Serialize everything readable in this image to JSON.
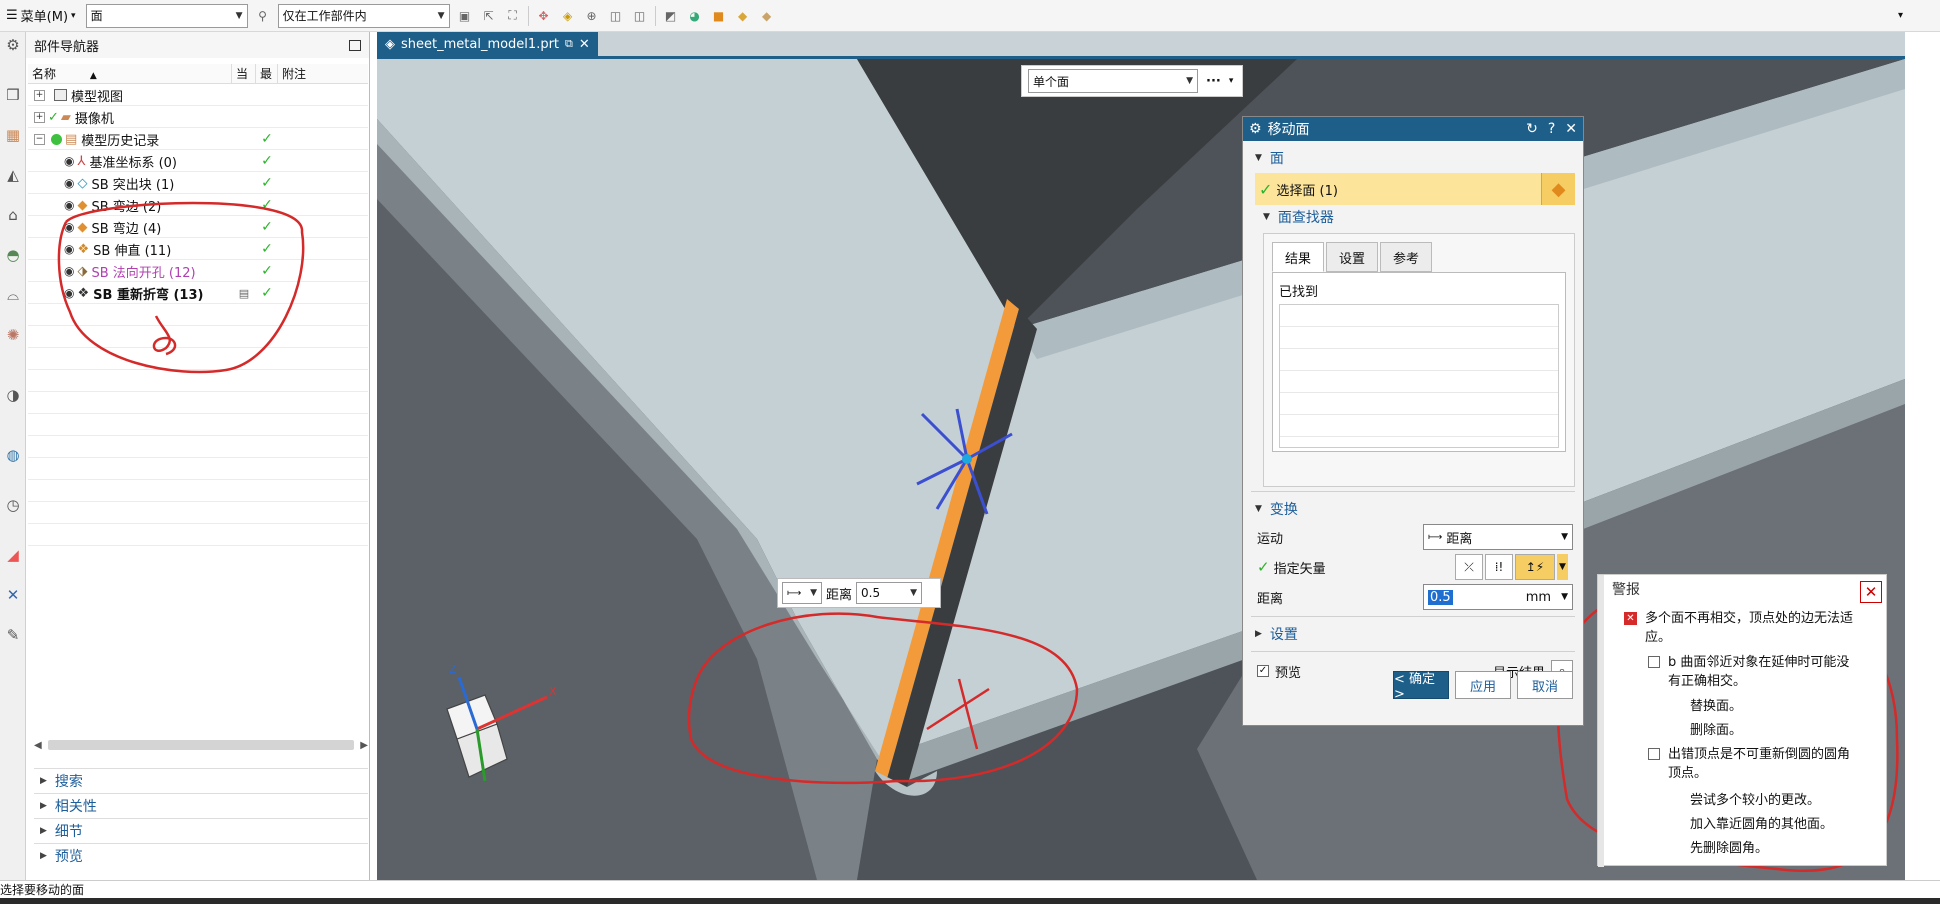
{
  "toolbar": {
    "menu_label": "菜单(M)",
    "filter_value": "面",
    "scope_value": "仅在工作部件内"
  },
  "navigator": {
    "title": "部件导航器",
    "columns": [
      "名称",
      "当",
      "最",
      "附注"
    ],
    "rows": [
      {
        "label": "模型视图",
        "level": 0,
        "expander": "+",
        "last": ""
      },
      {
        "label": "摄像机",
        "level": 0,
        "expander": "+",
        "last": ""
      },
      {
        "label": "模型历史记录",
        "level": 0,
        "expander": "−",
        "last": "✓"
      },
      {
        "label": "基准坐标系 (0)",
        "level": 1,
        "expander": "",
        "last": "✓"
      },
      {
        "label": "SB 突出块 (1)",
        "level": 1,
        "expander": "",
        "last": "✓"
      },
      {
        "label": "SB 弯边 (2)",
        "level": 1,
        "expander": "",
        "last": "✓"
      },
      {
        "label": "SB 弯边 (4)",
        "level": 1,
        "expander": "",
        "last": "✓"
      },
      {
        "label": "SB 伸直 (11)",
        "level": 1,
        "expander": "",
        "last": "✓"
      },
      {
        "label": "SB 法向开孔 (12)",
        "level": 1,
        "expander": "",
        "last": "✓"
      },
      {
        "label": "SB 重新折弯 (13)",
        "level": 1,
        "expander": "",
        "last": "✓"
      }
    ],
    "sections": [
      "搜索",
      "相关性",
      "细节",
      "预览"
    ]
  },
  "viewport": {
    "tab_label": "sheet_metal_model1.prt",
    "selection_value": "单个面",
    "dist_label": "距离",
    "dist_value": "0.5"
  },
  "dialog": {
    "title": "移动面",
    "group_face": "面",
    "select_face": "选择面 (1)",
    "face_finder": "面查找器",
    "tabs": [
      "结果",
      "设置",
      "参考"
    ],
    "found_label": "已找到",
    "group_transform": "变换",
    "motion_label": "运动",
    "motion_value": "距离",
    "vector_label": "指定矢量",
    "distance_label": "距离",
    "distance_value": "0.5",
    "distance_unit": "mm",
    "group_settings": "设置",
    "preview_label": "预览",
    "show_result_label": "显示结果",
    "ok_label": "< 确定 >",
    "apply_label": "应用",
    "cancel_label": "取消"
  },
  "alert": {
    "title": "警报",
    "message": "多个面不再相交，顶点处的边无法适应。",
    "cause1": "b 曲面邻近对象在延伸时可能没有正确相交。",
    "remedy1a": "替换面。",
    "remedy1b": "删除面。",
    "cause2": "出错顶点是不可重新倒圆的圆角顶点。",
    "remedy2a": "尝试多个较小的更改。",
    "remedy2b": "加入靠近圆角的其他面。",
    "remedy2c": "先删除圆角。"
  },
  "statusbar": {
    "text": "选择要移动的面"
  },
  "colors": {
    "accent": "#1e5f8a",
    "check": "#2db22d",
    "highlight": "#fce49a",
    "selected_edge": "#f39a3a",
    "annotation": "#d42a2a"
  }
}
